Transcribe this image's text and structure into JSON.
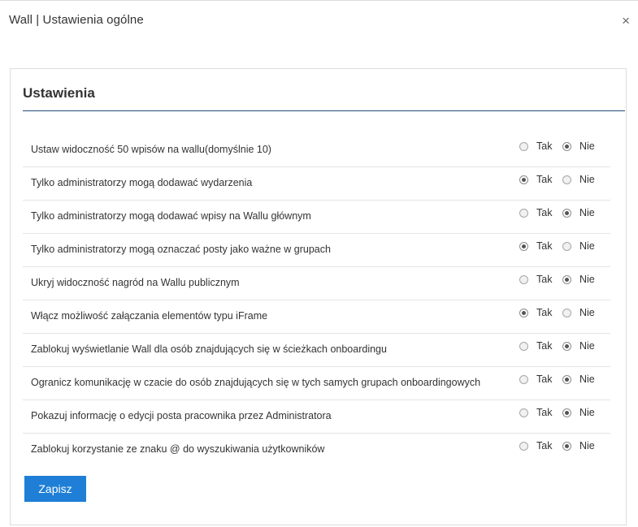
{
  "modal": {
    "title": "Wall | Ustawienia ogólne",
    "close_symbol": "×"
  },
  "panel": {
    "heading": "Ustawienia",
    "option_yes": "Tak",
    "option_no": "Nie",
    "save_label": "Zapisz",
    "settings": [
      {
        "label": "Ustaw widoczność 50 wpisów na wallu(domyślnie 10)",
        "value": "Nie"
      },
      {
        "label": "Tylko administratorzy mogą dodawać wydarzenia",
        "value": "Tak"
      },
      {
        "label": "Tylko administratorzy mogą dodawać wpisy na Wallu głównym",
        "value": "Nie"
      },
      {
        "label": "Tylko administratorzy mogą oznaczać posty jako ważne w grupach",
        "value": "Tak"
      },
      {
        "label": "Ukryj widoczność nagród na Wallu publicznym",
        "value": "Nie"
      },
      {
        "label": "Włącz możliwość załączania elementów typu iFrame",
        "value": "Tak"
      },
      {
        "label": "Zablokuj wyświetlanie Wall dla osób znajdujących się w ścieżkach onboardingu",
        "value": "Nie"
      },
      {
        "label": "Ogranicz komunikację w czacie do osób znajdujących się w tych samych grupach onboardingowych",
        "value": "Nie"
      },
      {
        "label": "Pokazuj informację o edycji posta pracownika przez Administratora",
        "value": "Nie"
      },
      {
        "label": "Zablokuj korzystanie ze znaku @ do wyszukiwania użytkowników",
        "value": "Nie"
      }
    ]
  },
  "colors": {
    "accent_button": "#1f7fd6",
    "heading_rule": "#1f4e79"
  }
}
